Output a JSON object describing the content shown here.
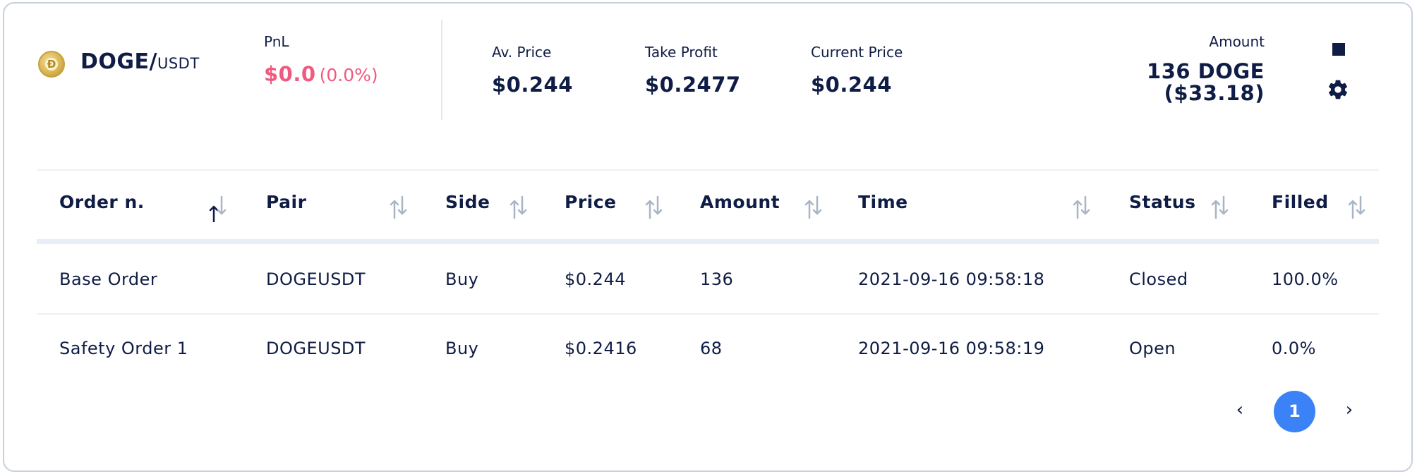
{
  "colors": {
    "text": "#0f1c45",
    "pnl": "#f05a7e",
    "accent": "#3b82f6",
    "sort_inactive": "#a9b4c6",
    "sort_active": "#0f1c45",
    "border": "#c7d0dc"
  },
  "header": {
    "coin_icon": "doge-coin-icon",
    "base": "DOGE/",
    "quote": "USDT",
    "pnl": {
      "label": "PnL",
      "value": "$0.0",
      "percent": "(0.0%)"
    },
    "avg_price": {
      "label": "Av. Price",
      "value": "$0.244"
    },
    "take_profit": {
      "label": "Take Profit",
      "value": "$0.2477"
    },
    "current_price": {
      "label": "Current Price",
      "value": "$0.244"
    },
    "amount": {
      "label": "Amount",
      "line1": "136 DOGE",
      "line2": "($33.18)"
    },
    "actions": {
      "stop_icon": "stop-icon",
      "settings_icon": "gear-icon"
    }
  },
  "table": {
    "columns": [
      {
        "label": "Order n.",
        "sort": "asc"
      },
      {
        "label": "Pair",
        "sort": "none"
      },
      {
        "label": "Side",
        "sort": "none"
      },
      {
        "label": "Price",
        "sort": "none"
      },
      {
        "label": "Amount",
        "sort": "none"
      },
      {
        "label": "Time",
        "sort": "none"
      },
      {
        "label": "Status",
        "sort": "none"
      },
      {
        "label": "Filled",
        "sort": "none"
      }
    ],
    "rows": [
      [
        "Base Order",
        "DOGEUSDT",
        "Buy",
        "$0.244",
        "136",
        "2021-09-16 09:58:18",
        "Closed",
        "100.0%"
      ],
      [
        "Safety Order 1",
        "DOGEUSDT",
        "Buy",
        "$0.2416",
        "68",
        "2021-09-16 09:58:19",
        "Open",
        "0.0%"
      ]
    ]
  },
  "pagination": {
    "prev": "‹",
    "current": "1",
    "next": "›"
  }
}
